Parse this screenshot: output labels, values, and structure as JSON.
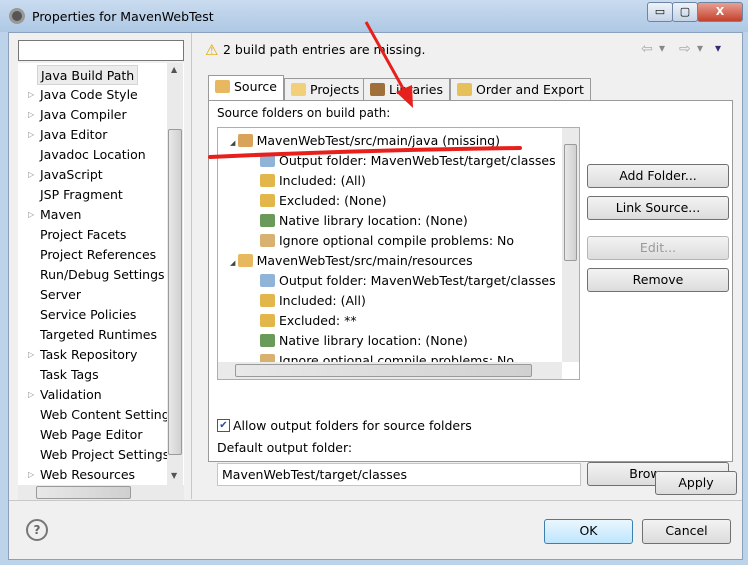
{
  "window": {
    "title": "Properties for MavenWebTest",
    "minimize": "▭",
    "maximize": "▢",
    "close": "X"
  },
  "sidebar": {
    "filter_value": "",
    "items": [
      {
        "label": "Java Build Path",
        "expandable": false,
        "selected": true
      },
      {
        "label": "Java Code Style",
        "expandable": true
      },
      {
        "label": "Java Compiler",
        "expandable": true
      },
      {
        "label": "Java Editor",
        "expandable": true
      },
      {
        "label": "Javadoc Location",
        "expandable": false
      },
      {
        "label": "JavaScript",
        "expandable": true
      },
      {
        "label": "JSP Fragment",
        "expandable": false
      },
      {
        "label": "Maven",
        "expandable": true
      },
      {
        "label": "Project Facets",
        "expandable": false
      },
      {
        "label": "Project References",
        "expandable": false
      },
      {
        "label": "Run/Debug Settings",
        "expandable": false
      },
      {
        "label": "Server",
        "expandable": false
      },
      {
        "label": "Service Policies",
        "expandable": false
      },
      {
        "label": "Targeted Runtimes",
        "expandable": false
      },
      {
        "label": "Task Repository",
        "expandable": true
      },
      {
        "label": "Task Tags",
        "expandable": false
      },
      {
        "label": "Validation",
        "expandable": true
      },
      {
        "label": "Web Content Settings",
        "expandable": false
      },
      {
        "label": "Web Page Editor",
        "expandable": false
      },
      {
        "label": "Web Project Settings",
        "expandable": false
      },
      {
        "label": "Web Resources",
        "expandable": true
      }
    ]
  },
  "header": {
    "message": "2 build path entries are missing.",
    "nav_back": "⇦",
    "nav_forward": "⇨",
    "dropdown": "▾"
  },
  "tabs": [
    {
      "label": "Source",
      "active": true
    },
    {
      "label": "Projects"
    },
    {
      "label": "Libraries"
    },
    {
      "label": "Order and Export"
    }
  ],
  "source": {
    "label": "Source folders on build path:",
    "rows": [
      {
        "text": "MavenWebTest/src/main/java (missing)",
        "level": 0,
        "icon": "package-folder-missing-icon"
      },
      {
        "text": "Output folder: MavenWebTest/target/classes",
        "level": 1,
        "icon": "output-folder-icon"
      },
      {
        "text": "Included: (All)",
        "level": 1,
        "icon": "inclusion-filter-icon"
      },
      {
        "text": "Excluded: (None)",
        "level": 1,
        "icon": "exclusion-filter-icon"
      },
      {
        "text": "Native library location: (None)",
        "level": 1,
        "icon": "native-library-icon"
      },
      {
        "text": "Ignore optional compile problems: No",
        "level": 1,
        "icon": "ignore-problems-icon"
      },
      {
        "text": "MavenWebTest/src/main/resources",
        "level": 0,
        "icon": "package-folder-icon"
      },
      {
        "text": "Output folder: MavenWebTest/target/classes",
        "level": 1,
        "icon": "output-folder-icon"
      },
      {
        "text": "Included: (All)",
        "level": 1,
        "icon": "inclusion-filter-icon"
      },
      {
        "text": "Excluded: **",
        "level": 1,
        "icon": "exclusion-filter-icon"
      },
      {
        "text": "Native library location: (None)",
        "level": 1,
        "icon": "native-library-icon"
      },
      {
        "text": "Ignore optional compile problems: No",
        "level": 1,
        "icon": "ignore-problems-icon"
      }
    ],
    "buttons": {
      "add_folder": "Add Folder...",
      "link_source": "Link Source...",
      "edit": "Edit...",
      "remove": "Remove"
    },
    "allow_output_label": "Allow output folders for source folders",
    "allow_output_checked": true,
    "default_output_label": "Default output folder:",
    "default_output_value": "MavenWebTest/target/classes",
    "browse": "Browse..."
  },
  "apply": "Apply",
  "ok": "OK",
  "cancel": "Cancel",
  "help": "?",
  "annotation_color": "#e8201c"
}
